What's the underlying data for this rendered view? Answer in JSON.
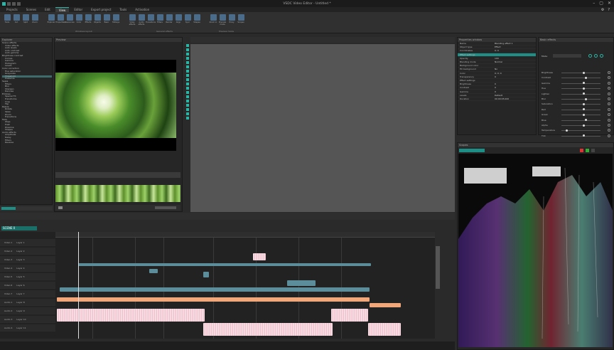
{
  "window": {
    "title": "VSDC Video Editor - Untitled *"
  },
  "menu": {
    "items": [
      "Projects",
      "Scenes",
      "Edit",
      "View",
      "Editor",
      "Export project",
      "Tools",
      "Activation"
    ],
    "active_index": 3
  },
  "ribbon": {
    "groups": [
      {
        "label": "",
        "buttons": [
          "Tools",
          "Cut",
          "Split",
          "Zoom"
        ]
      },
      {
        "label": "Windows layout",
        "buttons": [
          "Explorer",
          "Properties",
          "Resources",
          "Color",
          "Effects",
          "Objects",
          "Basic",
          "Hotkeys"
        ]
      },
      {
        "label": "General effects",
        "buttons": [
          "Video effects",
          "Audio effects",
          "Transitions",
          "Filters",
          "Render",
          "Align",
          "Sync",
          "Shapes"
        ]
      },
      {
        "label": "Preview mode",
        "buttons": [
          "Zoom in",
          "Preview mode",
          "Proxy",
          "Scopes"
        ]
      }
    ]
  },
  "panels": {
    "explorer": {
      "title": "Explorer"
    },
    "preview": {
      "title": "Preview"
    },
    "properties": {
      "title": "Properties window"
    },
    "adjustments": {
      "title": "Basic effects"
    },
    "scope": {
      "title": "Scopes"
    }
  },
  "explorer_tree": [
    "Scene effects",
    "Video effects",
    "Auto levels",
    "Auto contrast",
    "Auto gamma",
    "Brightness contrast",
    "Curves",
    "Gamma",
    "Histogram",
    "Levels",
    "Color correction",
    "Hue saturation",
    "Grayscale",
    "Threshold",
    "Posterize",
    "Sepia",
    "Filters",
    "Blur",
    "Sharpen",
    "Denoise",
    "Emboss",
    "Special FX",
    "Transforms",
    "Crop",
    "Flip",
    "Resize",
    "Rotate",
    "Skew",
    "Zoom",
    "Transitions",
    "Fade",
    "Wipe",
    "Push",
    "Dissolve",
    "Shapes",
    "Audio effects",
    "Amplitude",
    "Delay",
    "Filters",
    "Reverse"
  ],
  "explorer_selected_index": 13,
  "properties": {
    "rows": [
      {
        "label": "Name",
        "value": "Blending effect 1"
      },
      {
        "label": "Object type",
        "value": "Effect"
      },
      {
        "label": "Coordinates",
        "value": "0; 0"
      },
      {
        "label": "Opacity",
        "value": "100"
      },
      {
        "label": "Blending mode",
        "value": "Normal"
      },
      {
        "label": "Background color",
        "value": ""
      },
      {
        "label": "Fill background",
        "value": "No"
      },
      {
        "label": "Color",
        "value": "0; 0; 0"
      },
      {
        "label": "Transparency",
        "value": "0"
      },
      {
        "label": "Effect settings",
        "value": ""
      },
      {
        "label": "Brightness",
        "value": "0"
      },
      {
        "label": "Contrast",
        "value": "0"
      },
      {
        "label": "Gamma",
        "value": "0"
      },
      {
        "label": "Levels",
        "value": "Default"
      },
      {
        "label": "Duration",
        "value": "00:00:05.000"
      }
    ],
    "teal_label": "Effect settings"
  },
  "adjustments": {
    "mode_label": "Mode",
    "sliders": [
      {
        "label": "Brightness",
        "value": 0.5
      },
      {
        "label": "Contrast",
        "value": 0.55
      },
      {
        "label": "Gamma",
        "value": 0.5
      },
      {
        "label": "Hue",
        "value": 0.5
      },
      {
        "label": "Lighten",
        "value": 0.5
      },
      {
        "label": "Blur",
        "value": 0.55
      },
      {
        "label": "Saturation",
        "value": 0.5
      },
      {
        "label": "Red",
        "value": 0.5
      },
      {
        "label": "Green",
        "value": 0.5
      },
      {
        "label": "Blue",
        "value": 0.55
      },
      {
        "label": "Alpha",
        "value": 0.5
      },
      {
        "label": "Temperature",
        "value": 0.1
      },
      {
        "label": "Tint",
        "value": 0.5
      }
    ]
  },
  "timeline": {
    "tab_label": "SCENE 0",
    "tracks": [
      {
        "name": "Video 1",
        "type": "Layer 1"
      },
      {
        "name": "Video 2",
        "type": "Layer 2"
      },
      {
        "name": "Video 3",
        "type": "Layer 3"
      },
      {
        "name": "Video 4",
        "type": "Layer 4"
      },
      {
        "name": "Video 5",
        "type": "Layer 5"
      },
      {
        "name": "Video 6",
        "type": "Layer 6"
      },
      {
        "name": "Video 7",
        "type": "Layer 7"
      },
      {
        "name": "Audio 1",
        "type": "Layer 8"
      },
      {
        "name": "Audio 2",
        "type": "Layer 9"
      },
      {
        "name": "Audio 3",
        "type": "Layer 10"
      },
      {
        "name": "Audio 4",
        "type": "Layer 11"
      }
    ]
  },
  "colors": {
    "accent": "#2bb5a6",
    "clip_video": "#5b8e9a",
    "clip_audio": "#f3c3cf",
    "clip_orange": "#f2a77a"
  }
}
